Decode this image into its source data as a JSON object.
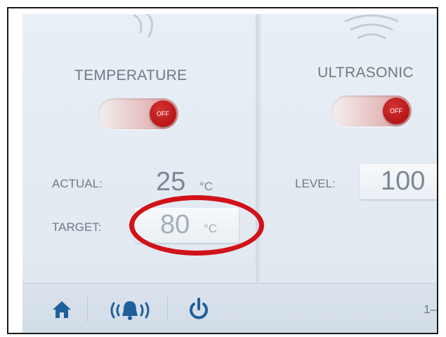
{
  "temperature": {
    "title": "TEMPERATURE",
    "toggle_state": "OFF",
    "actual_label": "ACTUAL:",
    "actual_value": "25",
    "actual_unit": "°C",
    "target_label": "TARGET:",
    "target_value": "80",
    "target_unit": "°C"
  },
  "ultrasonic": {
    "title": "ULTRASONIC",
    "toggle_state": "OFF",
    "level_label": "LEVEL:",
    "level_value": "100",
    "level_unit": "%"
  },
  "bottom_bar": {
    "home_icon": "home-icon",
    "alarm_icon": "alarm-bell-icon",
    "power_icon": "power-icon",
    "page_indicator": "1–"
  },
  "colors": {
    "accent_blue": "#1f5f9c",
    "toggle_red": "#c11a1a",
    "highlight_ring": "#d11219"
  }
}
